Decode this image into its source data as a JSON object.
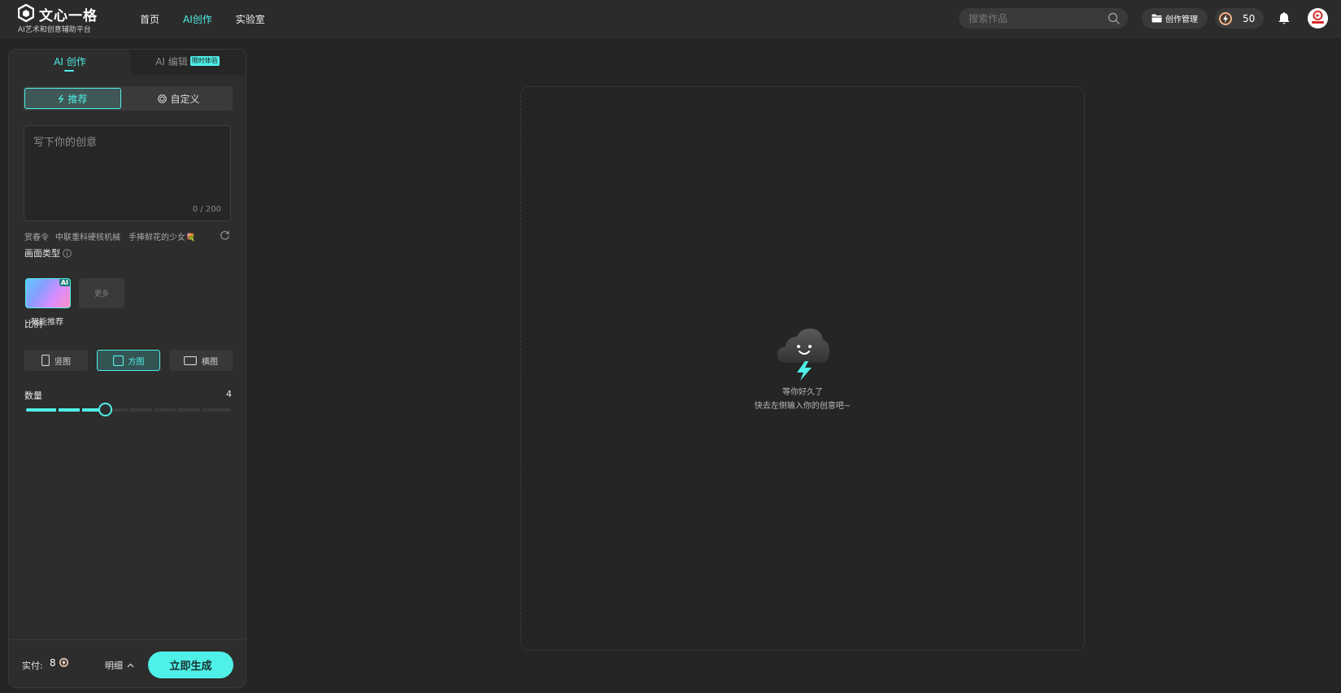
{
  "header": {
    "logo_title": "文心一格",
    "logo_subtitle": "AI艺术和创意辅助平台",
    "nav": [
      {
        "label": "首页",
        "active": false
      },
      {
        "label": "AI创作",
        "active": true
      },
      {
        "label": "实验室",
        "active": false
      }
    ],
    "search_placeholder": "搜索作品",
    "manage_label": "创作管理",
    "points": "50",
    "accent_color": "#4ff0e7"
  },
  "panel": {
    "tab_create": "AI 创作",
    "tab_edit": "AI 编辑",
    "tab_edit_badge": "限时体验",
    "mode_recommend": "推荐",
    "mode_custom": "自定义",
    "prompt_placeholder": "写下你的创意",
    "prompt_value": "",
    "char_count": "0 / 200",
    "suggestions": [
      "赏春令",
      "中联重科硬核机械",
      "手捧鲜花的少女💐"
    ],
    "type_label": "画面类型",
    "type_ai_tag": "AI",
    "type_more": "更多",
    "type_selected_name": "智能推荐",
    "ratio_label": "比例",
    "ratios": [
      {
        "label": "竖图",
        "active": false
      },
      {
        "label": "方图",
        "active": true
      },
      {
        "label": "横图",
        "active": false
      }
    ],
    "count_label": "数量",
    "count_value": "4",
    "count_min": 1,
    "count_max": 9,
    "pay_label": "实付:",
    "pay_value": "8",
    "detail_label": "明细",
    "generate_label": "立即生成"
  },
  "canvas": {
    "empty_title": "等你好久了",
    "empty_subtitle": "快去左侧输入你的创意吧~"
  }
}
